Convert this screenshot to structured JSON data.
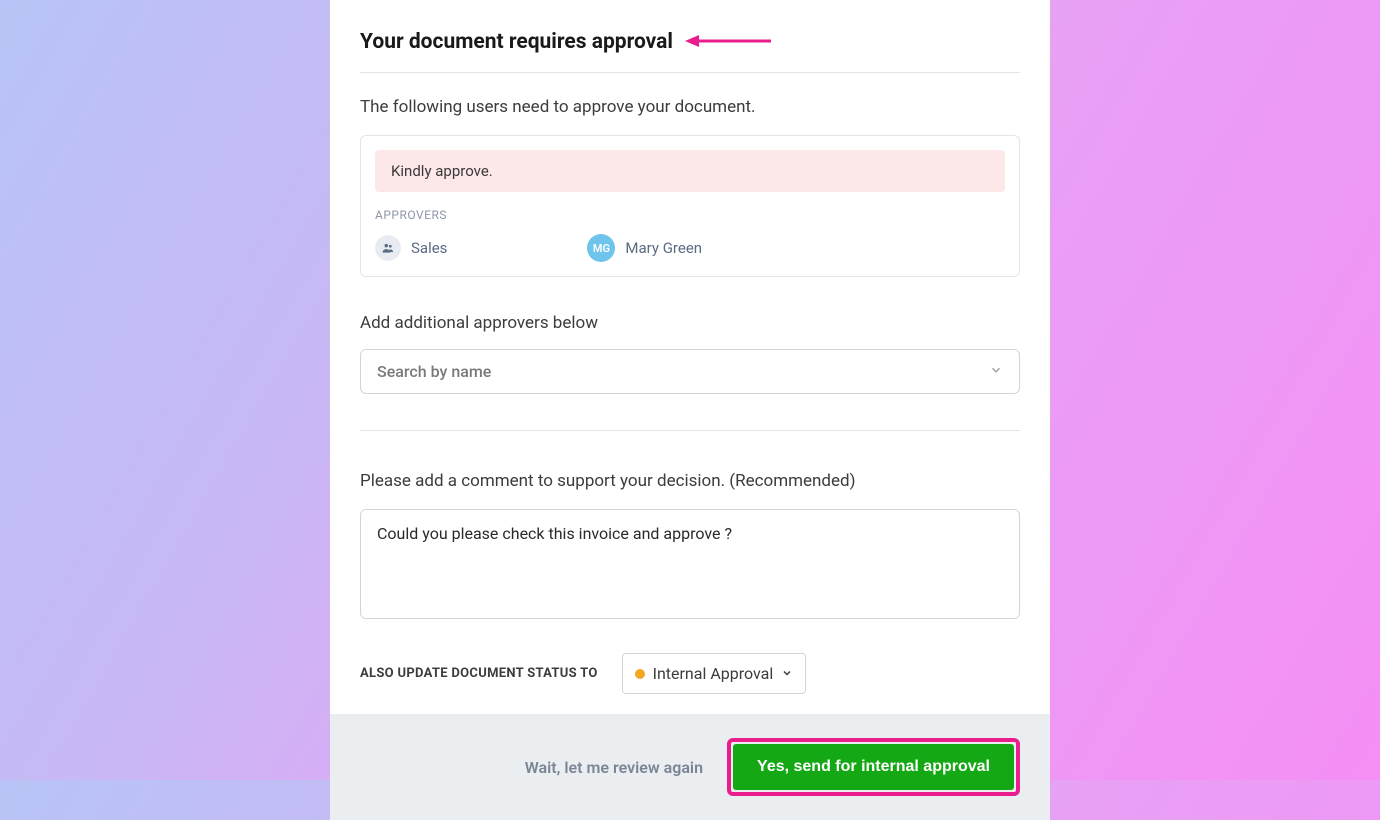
{
  "header": {
    "title": "Your document requires approval"
  },
  "intro": "The following users need to approve your document.",
  "notice": "Kindly approve.",
  "approvers_label": "APPROVERS",
  "approvers": [
    {
      "name": "Sales",
      "initials": ""
    },
    {
      "name": "Mary Green",
      "initials": "MG"
    }
  ],
  "add_approvers_label": "Add additional approvers below",
  "search_placeholder": "Search by name",
  "comment_label": "Please add a comment to support your decision. (Recommended)",
  "comment_value": "Could you please check this invoice and approve ?",
  "status_update_label": "ALSO UPDATE DOCUMENT STATUS TO",
  "status_value": "Internal Approval",
  "footer": {
    "cancel": "Wait, let me review again",
    "confirm": "Yes, send for internal approval"
  },
  "colors": {
    "primary_green": "#14a814",
    "highlight_pink": "#e91e8c",
    "status_dot": "#f5a623"
  }
}
